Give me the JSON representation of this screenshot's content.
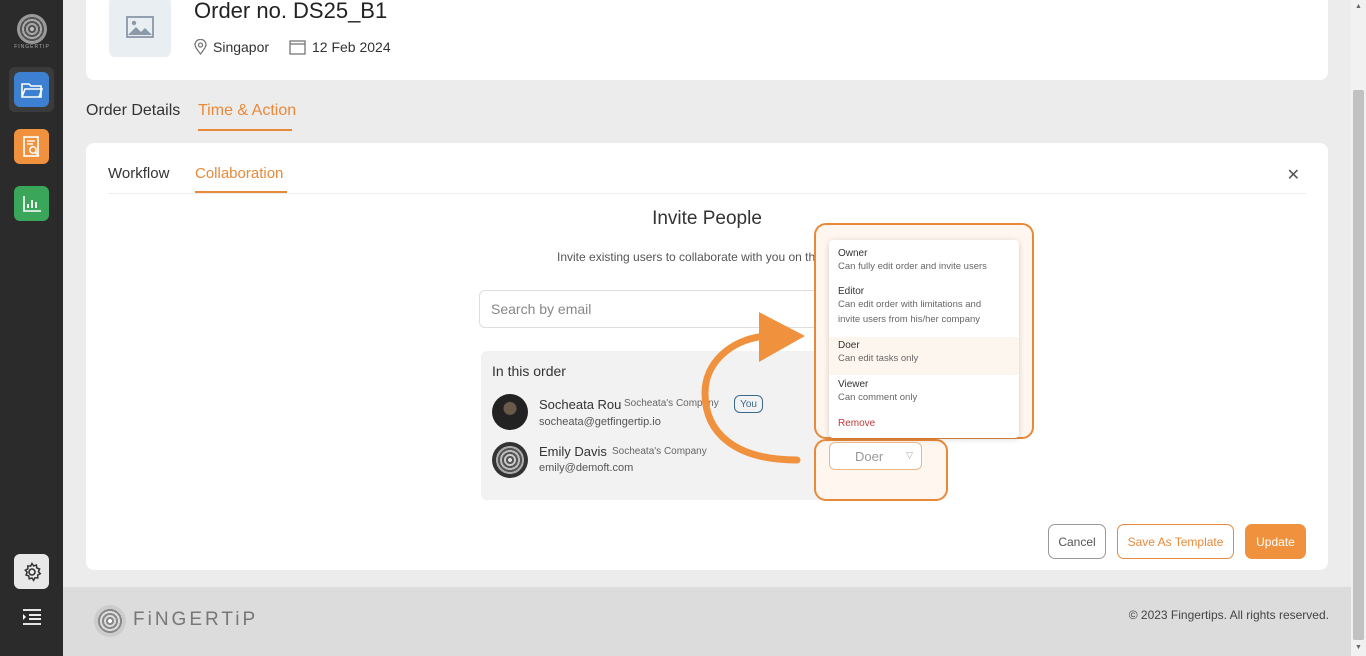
{
  "sidebar": {
    "brand_mini": "FINGERTIP",
    "items": [
      {
        "name": "orders",
        "icon": "folder-icon"
      },
      {
        "name": "reports",
        "icon": "document-search-icon"
      },
      {
        "name": "analytics",
        "icon": "bar-chart-icon"
      }
    ],
    "settings_icon": "gear-icon",
    "menu_icon": "menu-icon"
  },
  "order": {
    "title": "Order no. DS25_B1",
    "location": "Singapor",
    "date": "12 Feb 2024"
  },
  "main_tabs": [
    {
      "label": "Order Details",
      "active": false
    },
    {
      "label": "Time & Action",
      "active": true
    }
  ],
  "sub_tabs": [
    {
      "label": "Workflow",
      "active": false
    },
    {
      "label": "Collaboration",
      "active": true
    }
  ],
  "invite": {
    "title": "Invite People",
    "subtitle": "Invite existing users to collaborate with you on this",
    "search_placeholder": "Search by email",
    "members_title": "In this order",
    "members": [
      {
        "name": "Socheata Rou",
        "company": "Socheata's Company",
        "email": "socheata@getfingertip.io",
        "badge": "You"
      },
      {
        "name": "Emily Davis",
        "company": "Socheata's Company",
        "email": "emily@demoft.com",
        "role": "Doer"
      }
    ]
  },
  "role_menu": {
    "options": [
      {
        "label": "Owner",
        "desc": "Can fully edit order and invite users"
      },
      {
        "label": "Editor",
        "desc": "Can edit order with limitations and invite users from his/her company"
      },
      {
        "label": "Doer",
        "desc": "Can edit tasks only",
        "selected": true
      },
      {
        "label": "Viewer",
        "desc": "Can comment only"
      }
    ],
    "remove_label": "Remove"
  },
  "buttons": {
    "cancel": "Cancel",
    "save_template": "Save As Template",
    "update": "Update"
  },
  "footer": {
    "brand": "FiNGERTiP",
    "copyright": "© 2023 Fingertips. All rights reserved."
  },
  "colors": {
    "accent": "#e8893a",
    "sidebar_bg": "#2b2b2b",
    "active_blue": "#3d7fd0",
    "green": "#3aa65a"
  }
}
